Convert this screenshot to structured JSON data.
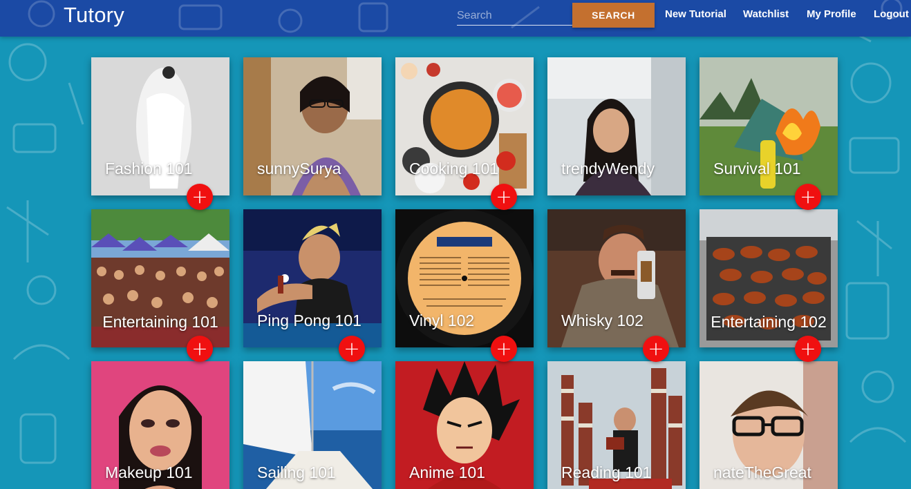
{
  "app": {
    "brand": "Tutory",
    "search": {
      "placeholder": "Search",
      "value": "",
      "button_label": "SEARCH"
    },
    "nav_links": [
      "New Tutorial",
      "Watchlist",
      "My Profile",
      "Logout"
    ],
    "colors": {
      "navbar": "#1b4aa5",
      "background": "#1596b8",
      "search_button": "#c4702f",
      "add_button": "#f01010"
    }
  },
  "cards": [
    {
      "title": "Fashion 101",
      "image": "fashion-photo",
      "add_icon": "plus-icon"
    },
    {
      "title": "sunnySurya",
      "image": "profile-photo",
      "add_icon": "plus-icon"
    },
    {
      "title": "Cooking 101",
      "image": "cooking-photo",
      "add_icon": "plus-icon"
    },
    {
      "title": "trendyWendy",
      "image": "profile-photo",
      "add_icon": "plus-icon"
    },
    {
      "title": "Survival 101",
      "image": "survival-photo",
      "add_icon": "plus-icon"
    },
    {
      "title": "Entertaining 101",
      "image": "party-photo",
      "add_icon": "plus-icon"
    },
    {
      "title": "Ping Pong 101",
      "image": "ping-pong-photo",
      "add_icon": "plus-icon"
    },
    {
      "title": "Vinyl 102",
      "image": "vinyl-record-photo",
      "add_icon": "plus-icon"
    },
    {
      "title": "Whisky 102",
      "image": "whisky-photo",
      "add_icon": "plus-icon"
    },
    {
      "title": "Entertaining 102",
      "image": "grill-photo",
      "add_icon": "plus-icon"
    },
    {
      "title": "Makeup 101",
      "image": "makeup-photo",
      "add_icon": "plus-icon"
    },
    {
      "title": "Sailing 101",
      "image": "sailing-photo",
      "add_icon": "plus-icon"
    },
    {
      "title": "Anime 101",
      "image": "anime-photo",
      "add_icon": "plus-icon"
    },
    {
      "title": "Reading 101",
      "image": "reading-photo",
      "add_icon": "plus-icon"
    },
    {
      "title": "nateTheGreat",
      "image": "profile-photo",
      "add_icon": "plus-icon"
    }
  ],
  "add_label": "+"
}
